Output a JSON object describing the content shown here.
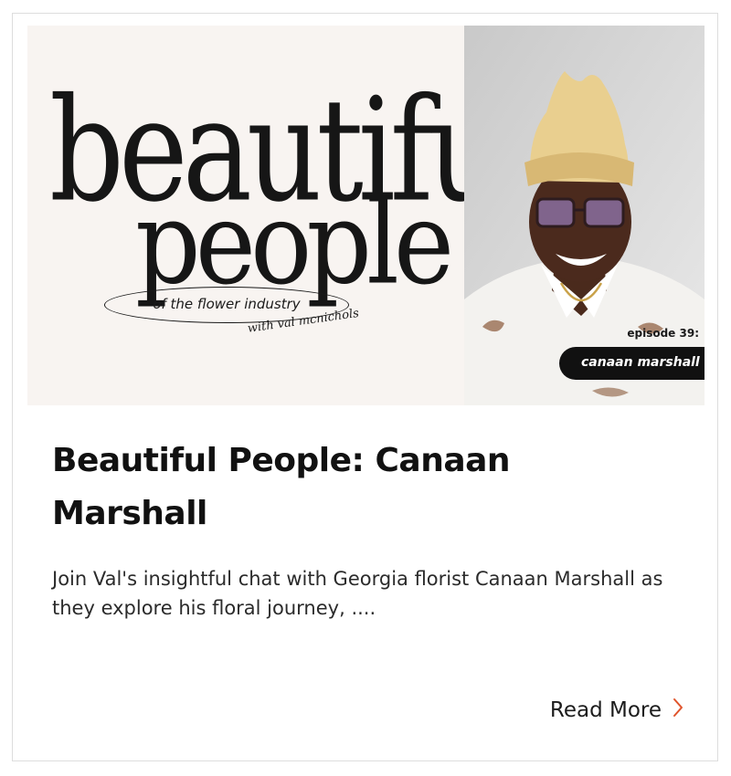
{
  "post": {
    "title": "Beautiful People: Canaan Marshall",
    "excerpt": "Join Val's insightful chat with Georgia florist Canaan Marshall as they explore his floral journey, ....",
    "read_more_label": "Read More",
    "read_more_icon": "chevron-right-icon",
    "accent_color": "#e0542c"
  },
  "hero": {
    "wordmark_line1": "beautiful",
    "wordmark_line2": "people",
    "tagline": "of the flower industry",
    "host": "with val mcnichols",
    "episode_label": "episode 39:",
    "guest_name": "canaan marshall",
    "background_color": "#f8f4f1"
  }
}
